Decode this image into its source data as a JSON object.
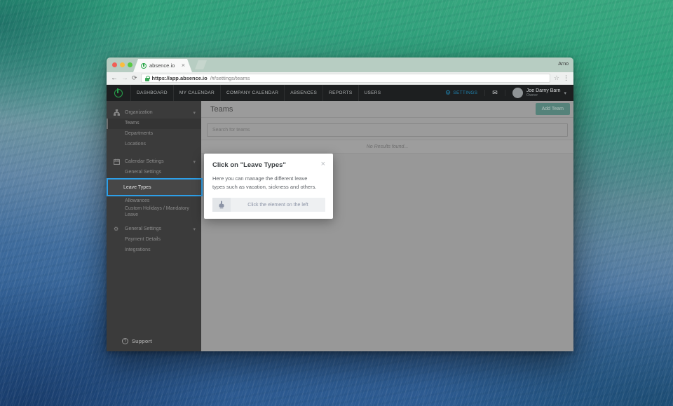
{
  "browser": {
    "profile": "Arno",
    "tab": {
      "title": "absence.io",
      "close": "×"
    },
    "url_host": "https://app.absence.io",
    "url_path": "/#/settings/teams",
    "back": "←",
    "forward": "→",
    "reload": "⟳",
    "star": "☆",
    "menu": "⋮"
  },
  "nav": {
    "items": [
      "DASHBOARD",
      "MY CALENDAR",
      "COMPANY CALENDAR",
      "ABSENCES",
      "REPORTS",
      "USERS"
    ],
    "settings_label": "SETTINGS",
    "gear_glyph": "⚙",
    "mail_glyph": "✉",
    "user": {
      "name": "Joe Darny Barn",
      "role": "Owner",
      "caret": "▾"
    }
  },
  "sidebar": {
    "sections": [
      {
        "label": "Organization",
        "chevron": "▾",
        "items": [
          "Teams",
          "Departments",
          "Locations"
        ]
      },
      {
        "label": "Calendar Settings",
        "chevron": "▾",
        "items": [
          "General Settings",
          "Leave Types",
          "Allowances",
          "Custom Holidays / Mandatory Leave"
        ]
      },
      {
        "label": "General Settings",
        "chevron": "▾",
        "gear_glyph": "⚙",
        "items": [
          "Payment Details",
          "Integrations"
        ]
      }
    ],
    "support": {
      "icon": "?",
      "label": "Support"
    }
  },
  "main": {
    "title": "Teams",
    "add_button": "Add Team",
    "search_placeholder": "Search for teams",
    "empty_text": "No Results found..."
  },
  "popup": {
    "title": "Click on \"Leave Types\"",
    "close": "×",
    "body": "Here you can manage the different leave types such as vacation, sickness and others.",
    "footer": "Click the element on the left"
  },
  "colors": {
    "highlight_blue": "#2d9fe8",
    "settings_blue": "#1f86b4",
    "brand_green": "#27a24b",
    "add_button_teal": "#55827a",
    "dim_overlay_grey": "#9b9b9b"
  }
}
